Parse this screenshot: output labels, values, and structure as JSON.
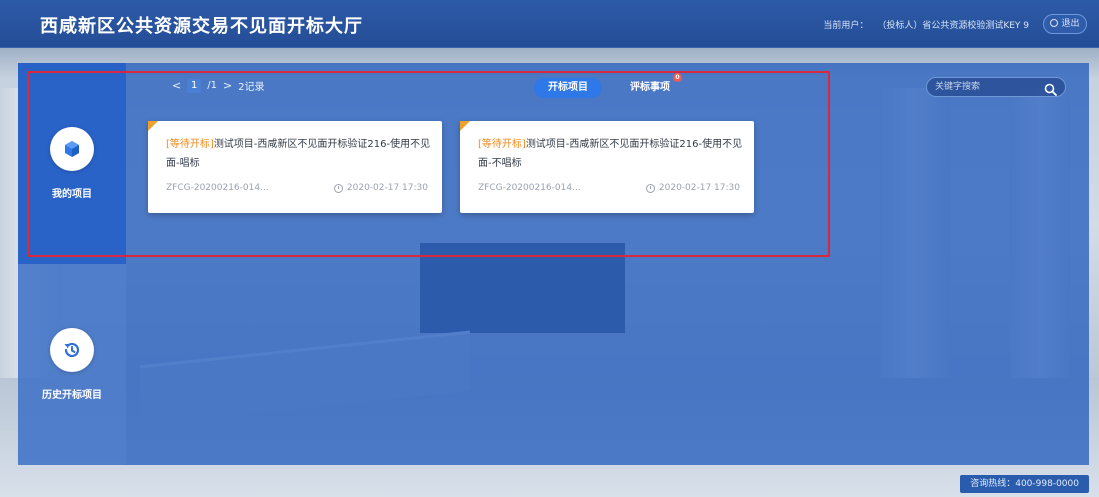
{
  "header": {
    "title": "西咸新区公共资源交易不见面开标大厅",
    "user_label": "当前用户：",
    "user_value": "（投标人）省公共资源校验测试KEY 9",
    "logout_label": "退出"
  },
  "sidebar": {
    "items": [
      {
        "label": "我的项目",
        "icon": "cube-icon",
        "active": true
      },
      {
        "label": "历史开标项目",
        "icon": "history-icon",
        "active": false
      }
    ]
  },
  "pager": {
    "prev": "<",
    "current": "1",
    "total": "/1",
    "next": ">",
    "count": "2记录"
  },
  "tabs": [
    {
      "label": "开标项目",
      "active": true,
      "badge": ""
    },
    {
      "label": "评标事项",
      "active": false,
      "badge": "0"
    }
  ],
  "search": {
    "placeholder": "关键字搜索"
  },
  "cards": [
    {
      "status": "[等待开标]",
      "title": "测试项目-西咸新区不见面开标验证216-使用不见面-唱标",
      "code": "ZFCG-20200216-014...",
      "time": "2020-02-17 17:30"
    },
    {
      "status": "[等待开标]",
      "title": "测试项目-西咸新区不见面开标验证216-使用不见面-不唱标",
      "code": "ZFCG-20200216-014...",
      "time": "2020-02-17 17:30"
    }
  ],
  "footer": {
    "hotline": "咨询热线：400-998-0000"
  },
  "colors": {
    "accent": "#2f78e8",
    "status": "#f08a1c",
    "highlight_border": "#d8283c"
  }
}
